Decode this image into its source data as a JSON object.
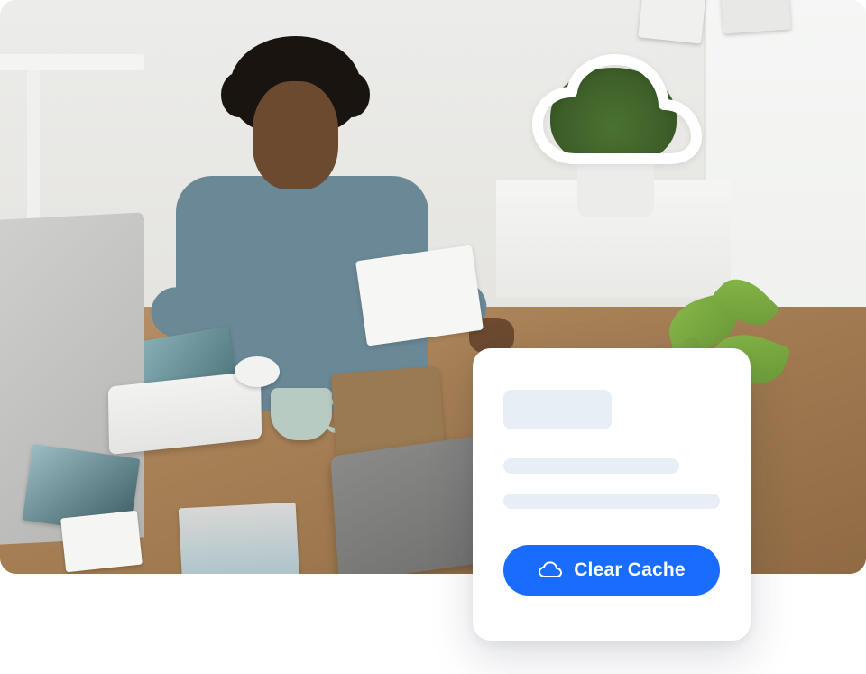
{
  "overlay": {
    "cloud_icon_name": "cloud-icon"
  },
  "card": {
    "button": {
      "icon_name": "cloud-icon",
      "label": "Clear Cache"
    }
  },
  "colors": {
    "accent": "#1a6cff",
    "skeleton": "#e7eef6",
    "card_bg": "#ffffff"
  }
}
